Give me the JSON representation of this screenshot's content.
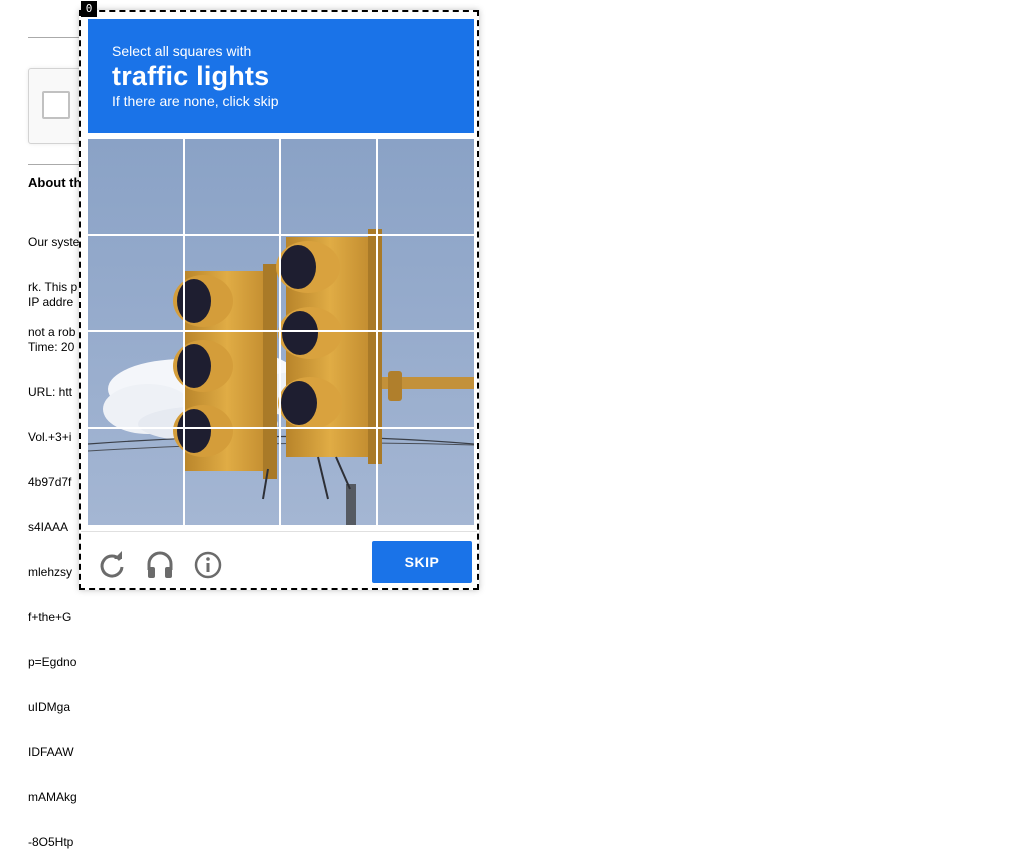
{
  "background_page": {
    "about_heading": "About th",
    "paragraph_lines": [
      "Our syste",
      "rk. This p",
      "not a rob"
    ],
    "details_lines": [
      "IP addre",
      "Time: 20",
      "URL: htt",
      "Vol.+3+i",
      "4b97d7f",
      "s4IAAA",
      "mlehzsy",
      "f+the+G",
      "p=Egdno",
      "uIDMga",
      "IDFAAW",
      "mAMAkg",
      "-8O5Htp"
    ]
  },
  "challenge": {
    "frame_index": "0",
    "instruction_top": "Select all squares with",
    "target": "traffic lights",
    "instruction_bottom": "If there are none, click skip",
    "skip_label": "SKIP",
    "icons": {
      "reload": "reload-icon",
      "audio": "headphones-icon",
      "info": "info-icon"
    },
    "colors": {
      "accent": "#1a73e8",
      "sky": "#8aa2c6",
      "light_housing": "#d7a23a"
    }
  }
}
